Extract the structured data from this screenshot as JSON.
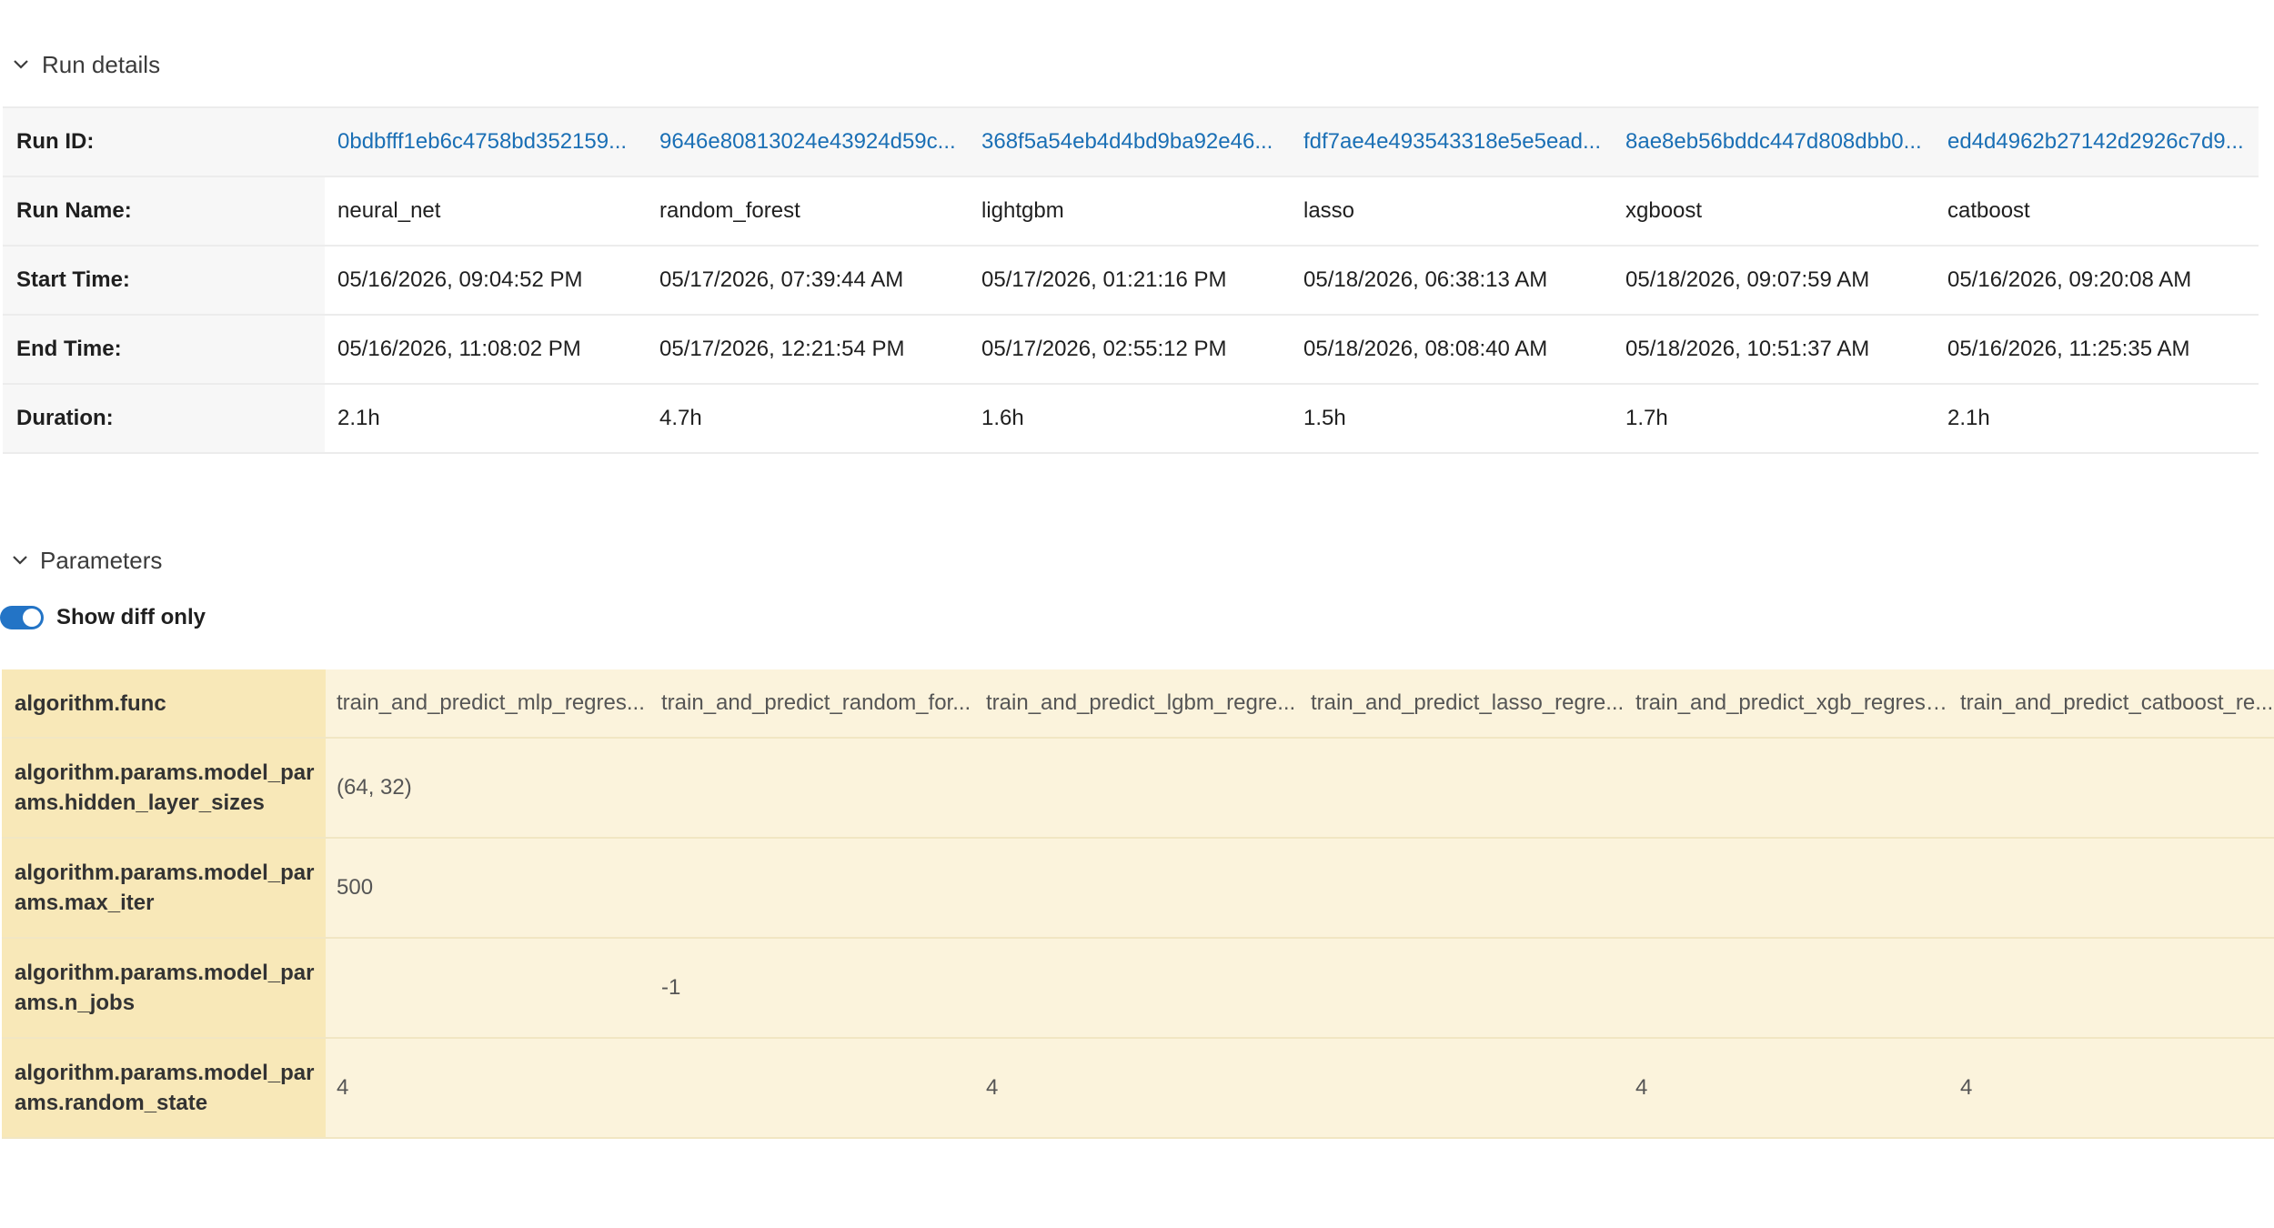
{
  "run_details": {
    "title": "Run details",
    "rows": [
      {
        "label": "Run ID:",
        "values": [
          "0bdbfff1eb6c4758bd352159...",
          "9646e80813024e43924d59c...",
          "368f5a54eb4d4bd9ba92e46...",
          "fdf7ae4e493543318e5e5ead...",
          "8ae8eb56bddc447d808dbb0...",
          "ed4d4962b27142d2926c7d9..."
        ]
      },
      {
        "label": "Run Name:",
        "values": [
          "neural_net",
          "random_forest",
          "lightgbm",
          "lasso",
          "xgboost",
          "catboost"
        ]
      },
      {
        "label": "Start Time:",
        "values": [
          "05/16/2026, 09:04:52 PM",
          "05/17/2026, 07:39:44 AM",
          "05/17/2026, 01:21:16 PM",
          "05/18/2026, 06:38:13 AM",
          "05/18/2026, 09:07:59 AM",
          "05/16/2026, 09:20:08 AM"
        ]
      },
      {
        "label": "End Time:",
        "values": [
          "05/16/2026, 11:08:02 PM",
          "05/17/2026, 12:21:54 PM",
          "05/17/2026, 02:55:12 PM",
          "05/18/2026, 08:08:40 AM",
          "05/18/2026, 10:51:37 AM",
          "05/16/2026, 11:25:35 AM"
        ]
      },
      {
        "label": "Duration:",
        "values": [
          "2.1h",
          "4.7h",
          "1.6h",
          "1.5h",
          "1.7h",
          "2.1h"
        ]
      }
    ]
  },
  "parameters": {
    "title": "Parameters",
    "toggle_label": "Show diff only",
    "toggle_on": true,
    "rows": [
      {
        "label": "algorithm.func",
        "values": [
          "train_and_predict_mlp_regres...",
          "train_and_predict_random_for...",
          "train_and_predict_lgbm_regre...",
          "train_and_predict_lasso_regre...",
          "train_and_predict_xgb_regress...",
          "train_and_predict_catboost_re..."
        ]
      },
      {
        "label": "algorithm.params.model_params.hidden_layer_sizes",
        "values": [
          "(64, 32)",
          "",
          "",
          "",
          "",
          ""
        ]
      },
      {
        "label": "algorithm.params.model_params.max_iter",
        "values": [
          "500",
          "",
          "",
          "",
          "",
          ""
        ]
      },
      {
        "label": "algorithm.params.model_params.n_jobs",
        "values": [
          "",
          "-1",
          "",
          "",
          "",
          ""
        ]
      },
      {
        "label": "algorithm.params.model_params.random_state",
        "values": [
          "4",
          "",
          "4",
          "",
          "4",
          "4"
        ]
      }
    ]
  },
  "colors": {
    "link": "#1a6fb5",
    "toggle_on": "#2374c6",
    "param_label_bg": "#f8e8b8",
    "param_cell_bg": "#fbf3dc"
  }
}
